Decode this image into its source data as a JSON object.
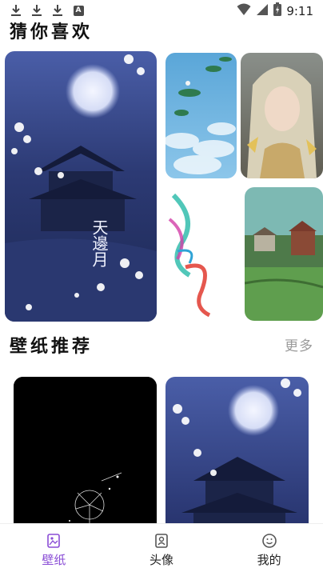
{
  "status_bar": {
    "time": "9:11",
    "left_icons": [
      "download-icon",
      "download-icon",
      "download-icon",
      "a-notification-icon"
    ],
    "a_label": "A",
    "right_icons": [
      "wifi-icon",
      "signal-icon",
      "battery-icon"
    ]
  },
  "guess_section": {
    "title": "猜你喜欢",
    "large_card_caption": "天邊月"
  },
  "recommend_section": {
    "title": "壁纸推荐",
    "more_label": "更多"
  },
  "bottom_nav": {
    "items": [
      {
        "label": "壁纸",
        "icon": "wallpaper-icon",
        "active": true
      },
      {
        "label": "头像",
        "icon": "avatar-icon",
        "active": false
      },
      {
        "label": "我的",
        "icon": "profile-smile-icon",
        "active": false
      }
    ]
  },
  "colors": {
    "accent": "#8a4dd6",
    "more_text": "#9a9a9a",
    "nav_text": "#222222"
  }
}
